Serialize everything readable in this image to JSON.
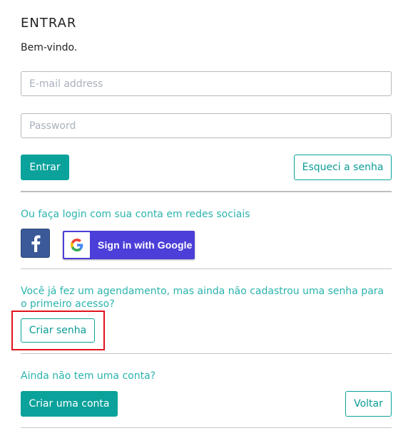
{
  "login": {
    "title": "ENTRAR",
    "welcome": "Bem-vindo.",
    "email_placeholder": "E-mail address",
    "password_placeholder": "Password",
    "submit_label": "Entrar",
    "forgot_label": "Esqueci a senha"
  },
  "social": {
    "heading": "Ou faça login com sua conta em redes sociais",
    "facebook_icon": "facebook-icon",
    "google_label": "Sign in with Google",
    "google_icon": "google-icon"
  },
  "first_access": {
    "text": "Você já fez um agendamento, mas ainda não cadastrou uma senha para o primeiro acesso?",
    "button_label": "Criar senha"
  },
  "signup": {
    "text": "Ainda não tem uma conta?",
    "create_label": "Criar uma conta",
    "back_label": "Voltar"
  },
  "colors": {
    "accent": "#0aa29b",
    "accent_text": "#2ab3ad",
    "facebook": "#3b5998",
    "google_button": "#4c3ed8",
    "highlight": "#e0141e"
  }
}
